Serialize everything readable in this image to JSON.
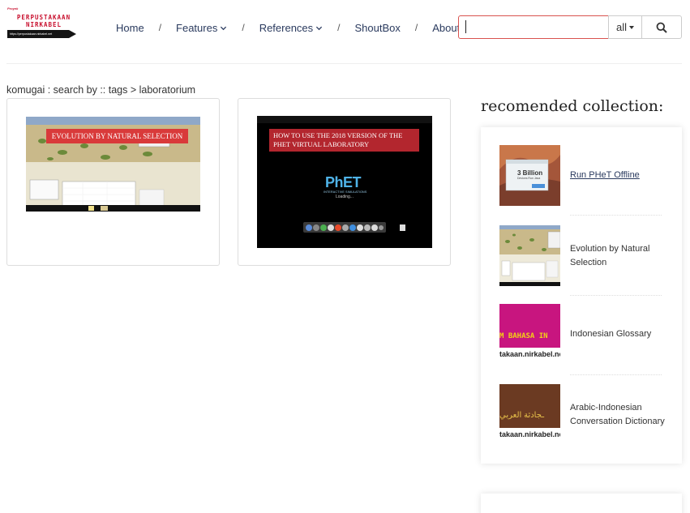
{
  "logo": {
    "tagline": "Proyek",
    "line1": "PERPUSTAKAAN",
    "line2": "NIRKABEL",
    "url": "https://perpustakaan.nirkabel.net"
  },
  "nav": {
    "home": "Home",
    "features": "Features",
    "references": "References",
    "shoutbox": "ShoutBox",
    "about": "About",
    "separator": "/"
  },
  "search": {
    "value": "",
    "scope": "all",
    "icon": "search-icon"
  },
  "breadcrumb": "komugai : search by :: tags > laboratorium",
  "results": [
    {
      "title": "EVOLUTION BY NATURAL SELECTION"
    },
    {
      "title": "HOW TO USE THE 2018 VERSION OF THE PHET VIRTUAL LABORATORY",
      "logo": "PhET",
      "logo_sub": "INTERACTIVE SIMULATIONS",
      "loading": "Loading..."
    }
  ],
  "recommended": {
    "heading": "recomended collection:",
    "items": [
      {
        "label": "Run PHeT Offline",
        "thumb_text": "3 Billion",
        "thumb_sub": "Devices Run Java"
      },
      {
        "label": "Evolution by Natural Selection"
      },
      {
        "label": "Indonesian Glossary",
        "thumb_text": "M BAHASA IN",
        "thumb_url": "takaan.nirkabel.ne"
      },
      {
        "label": "Arabic-Indonesian Conversation Dictionary",
        "thumb_text": "ـجادثة العربي",
        "thumb_url": "takaan.nirkabel.ne"
      }
    ]
  },
  "colors": {
    "accent": "#c8102e",
    "nav_text": "#2a3a5e",
    "search_border": "#d9534f",
    "glossary_bg": "#c8157f",
    "arabic_bg": "#6b3a22"
  }
}
